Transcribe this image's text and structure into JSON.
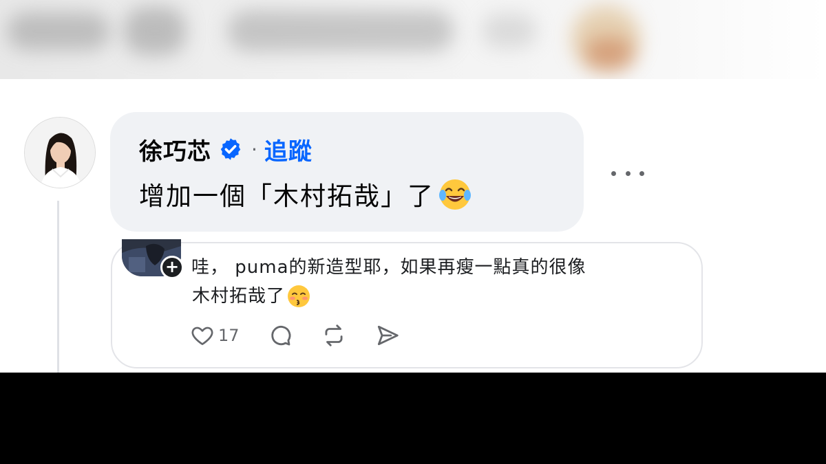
{
  "comment": {
    "author": "徐巧芯",
    "separator": "·",
    "follow_label": "追蹤",
    "text": "增加一個「木村拓哉」了",
    "emoji_icon": "face-with-tears-of-joy-icon"
  },
  "embedded_post": {
    "text_line1": "哇， puma的新造型耶，如果再瘦一點真的很像",
    "text_line2": "木村拓哉了",
    "emoji_icon": "kissing-face-icon",
    "like_count": "17"
  },
  "colors": {
    "accent_blue": "#0866ff",
    "bubble_bg": "#f0f2f5",
    "text_primary": "#050505",
    "text_secondary": "#65676b"
  }
}
